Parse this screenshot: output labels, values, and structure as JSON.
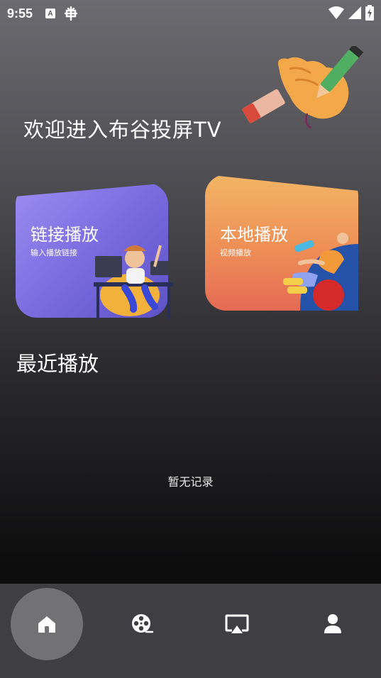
{
  "status_bar": {
    "time": "9:55",
    "a_badge": "A",
    "icons": [
      "text-a-icon",
      "bug-icon",
      "wifi-icon",
      "signal-icon",
      "battery-icon"
    ]
  },
  "welcome": {
    "title": "欢迎进入布谷投屏TV"
  },
  "cards": {
    "link": {
      "title": "链接播放",
      "subtitle": "输入播放链接",
      "color_start": "#9d8cf0",
      "color_end": "#5b52c6"
    },
    "local": {
      "title": "本地播放",
      "subtitle": "视频播放",
      "color_start": "#f2b565",
      "color_end": "#e56a55"
    }
  },
  "recent": {
    "title": "最近播放",
    "empty_text": "暂无记录"
  },
  "bottom_nav": {
    "items": [
      {
        "icon": "home-icon",
        "active": true
      },
      {
        "icon": "film-reel-icon",
        "active": false
      },
      {
        "icon": "cast-screen-icon",
        "active": false
      },
      {
        "icon": "user-icon",
        "active": false
      }
    ],
    "active_color": "#727174",
    "background": "#3f3e42"
  }
}
